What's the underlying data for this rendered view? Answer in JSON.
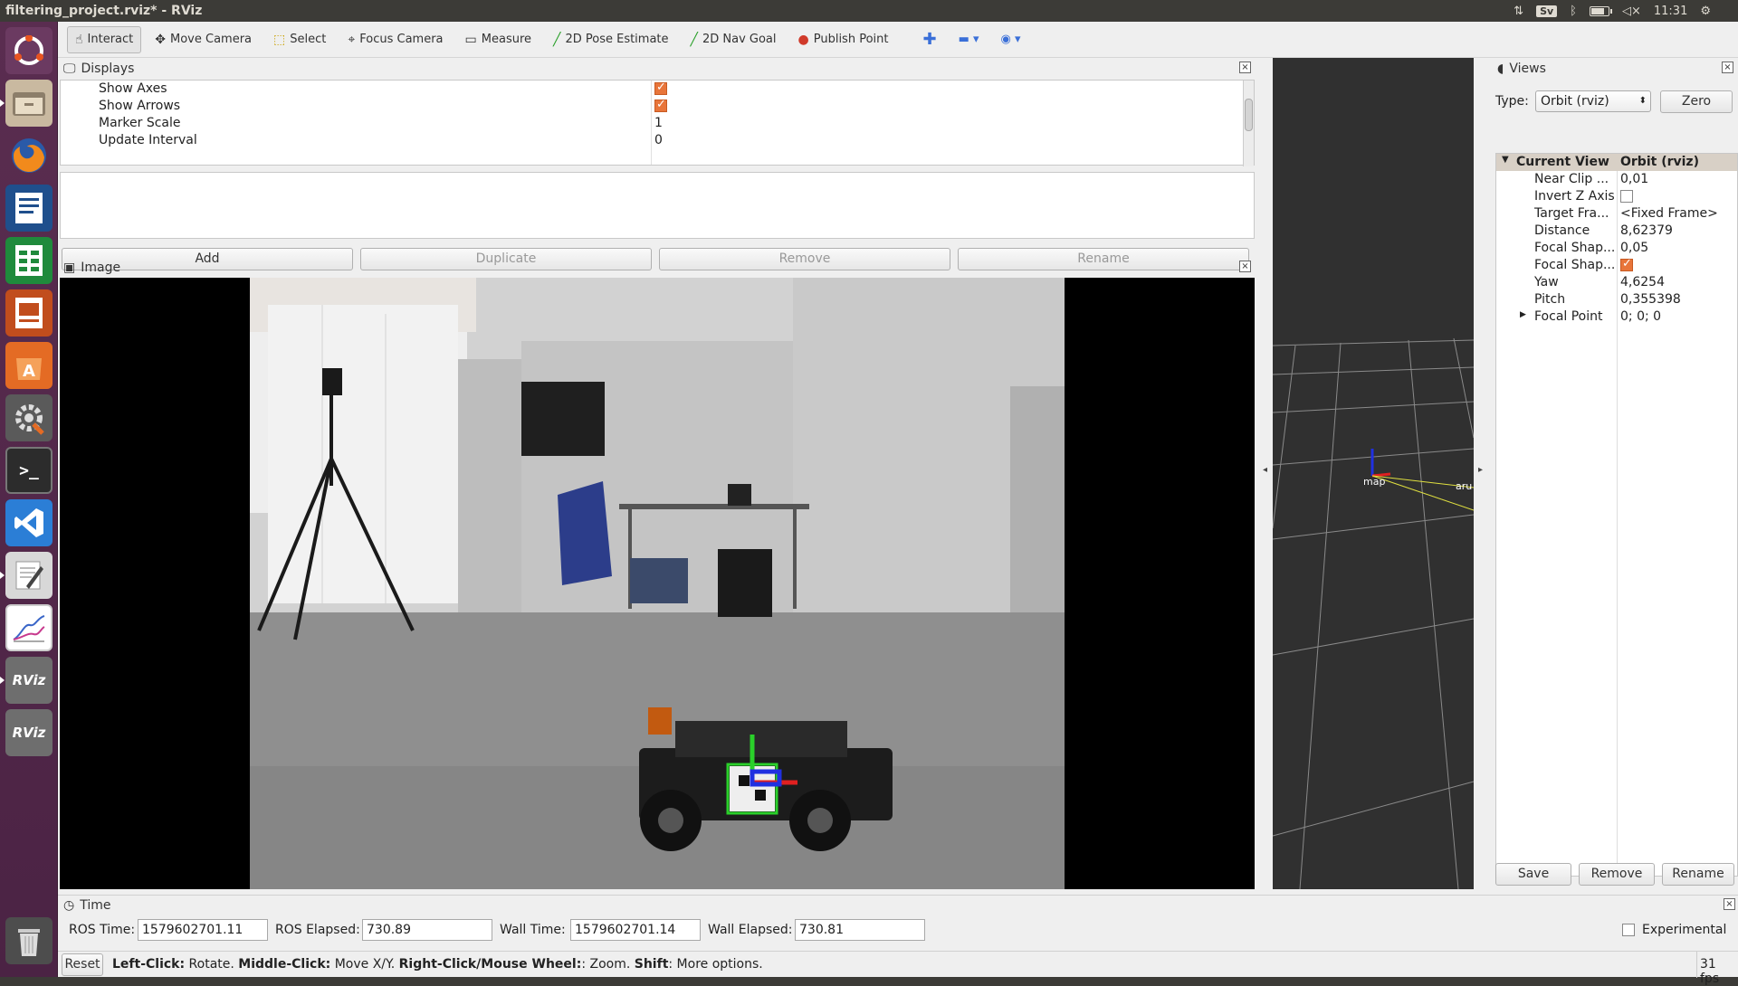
{
  "window": {
    "title": "filtering_project.rviz* - RViz"
  },
  "tray": {
    "keyboard": "Sv",
    "clock": "11:31"
  },
  "launcher": {
    "items": [
      {
        "name": "ubuntu-dash-icon",
        "glyph": "◎"
      },
      {
        "name": "files-icon",
        "glyph": "▤"
      },
      {
        "name": "firefox-icon",
        "glyph": "◉"
      },
      {
        "name": "writer-icon",
        "glyph": "≣"
      },
      {
        "name": "calc-icon",
        "glyph": "▦"
      },
      {
        "name": "impress-icon",
        "glyph": "▣"
      },
      {
        "name": "software-center-icon",
        "glyph": "A"
      },
      {
        "name": "settings-icon",
        "glyph": "⚙"
      },
      {
        "name": "terminal-icon",
        "glyph": ">_"
      },
      {
        "name": "vscode-icon",
        "glyph": "◀"
      },
      {
        "name": "text-editor-icon",
        "glyph": "✎"
      },
      {
        "name": "plot-icon",
        "glyph": "〰"
      },
      {
        "name": "rviz-icon",
        "glyph": "RViz"
      },
      {
        "name": "rviz-icon-2",
        "glyph": "RViz"
      },
      {
        "name": "trash-icon",
        "glyph": "🗑"
      }
    ]
  },
  "toolbar": {
    "tools": [
      {
        "label": "Interact",
        "icon": "hand-icon",
        "glyph": "☝"
      },
      {
        "label": "Move Camera",
        "icon": "move-camera-icon",
        "glyph": "✥"
      },
      {
        "label": "Select",
        "icon": "select-icon",
        "glyph": "⬚"
      },
      {
        "label": "Focus Camera",
        "icon": "focus-camera-icon",
        "glyph": "⌖"
      },
      {
        "label": "Measure",
        "icon": "measure-icon",
        "glyph": "▭"
      },
      {
        "label": "2D Pose Estimate",
        "icon": "pose-estimate-icon",
        "glyph": "╱"
      },
      {
        "label": "2D Nav Goal",
        "icon": "nav-goal-icon",
        "glyph": "╱"
      },
      {
        "label": "Publish Point",
        "icon": "publish-point-icon",
        "glyph": "📍"
      }
    ]
  },
  "displays": {
    "title": "Displays",
    "rows": [
      {
        "key": "Show Axes",
        "value": "",
        "checked": true
      },
      {
        "key": "Show Arrows",
        "value": "",
        "checked": true
      },
      {
        "key": "Marker Scale",
        "value": "1"
      },
      {
        "key": "Update Interval",
        "value": "0"
      }
    ],
    "buttons": {
      "add": "Add",
      "duplicate": "Duplicate",
      "remove": "Remove",
      "rename": "Rename"
    }
  },
  "image_panel": {
    "title": "Image"
  },
  "render": {
    "frame_map": "map",
    "frame_aruco": "aru"
  },
  "views": {
    "title": "Views",
    "type_label": "Type:",
    "type_value": "Orbit (rviz)",
    "zero": "Zero",
    "header_key": "Current View",
    "header_value": "Orbit (rviz)",
    "rows": [
      {
        "key": "Near Clip ...",
        "value": "0,01"
      },
      {
        "key": "Invert Z Axis",
        "value": "",
        "checkbox": false
      },
      {
        "key": "Target Fra...",
        "value": "<Fixed Frame>"
      },
      {
        "key": "Distance",
        "value": "8,62379"
      },
      {
        "key": "Focal Shap...",
        "value": "0,05"
      },
      {
        "key": "Focal Shap...",
        "value": "",
        "checkbox": true
      },
      {
        "key": "Yaw",
        "value": "4,6254"
      },
      {
        "key": "Pitch",
        "value": "0,355398"
      },
      {
        "key": "Focal Point",
        "value": "0; 0; 0"
      }
    ],
    "buttons": {
      "save": "Save",
      "remove": "Remove",
      "rename": "Rename"
    }
  },
  "time": {
    "title": "Time",
    "ros_time_label": "ROS Time:",
    "ros_time": "1579602701.11",
    "ros_elapsed_label": "ROS Elapsed:",
    "ros_elapsed": "730.89",
    "wall_time_label": "Wall Time:",
    "wall_time": "1579602701.14",
    "wall_elapsed_label": "Wall Elapsed:",
    "wall_elapsed": "730.81",
    "experimental": "Experimental"
  },
  "status": {
    "reset": "Reset",
    "hint_left_b": "Left-Click:",
    "hint_left": " Rotate. ",
    "hint_mid_b": "Middle-Click:",
    "hint_mid": " Move X/Y. ",
    "hint_right_b": "Right-Click/Mouse Wheel:",
    "hint_right": ": Zoom. ",
    "hint_shift_b": "Shift",
    "hint_shift": ": More options.",
    "fps": "31 fps"
  }
}
